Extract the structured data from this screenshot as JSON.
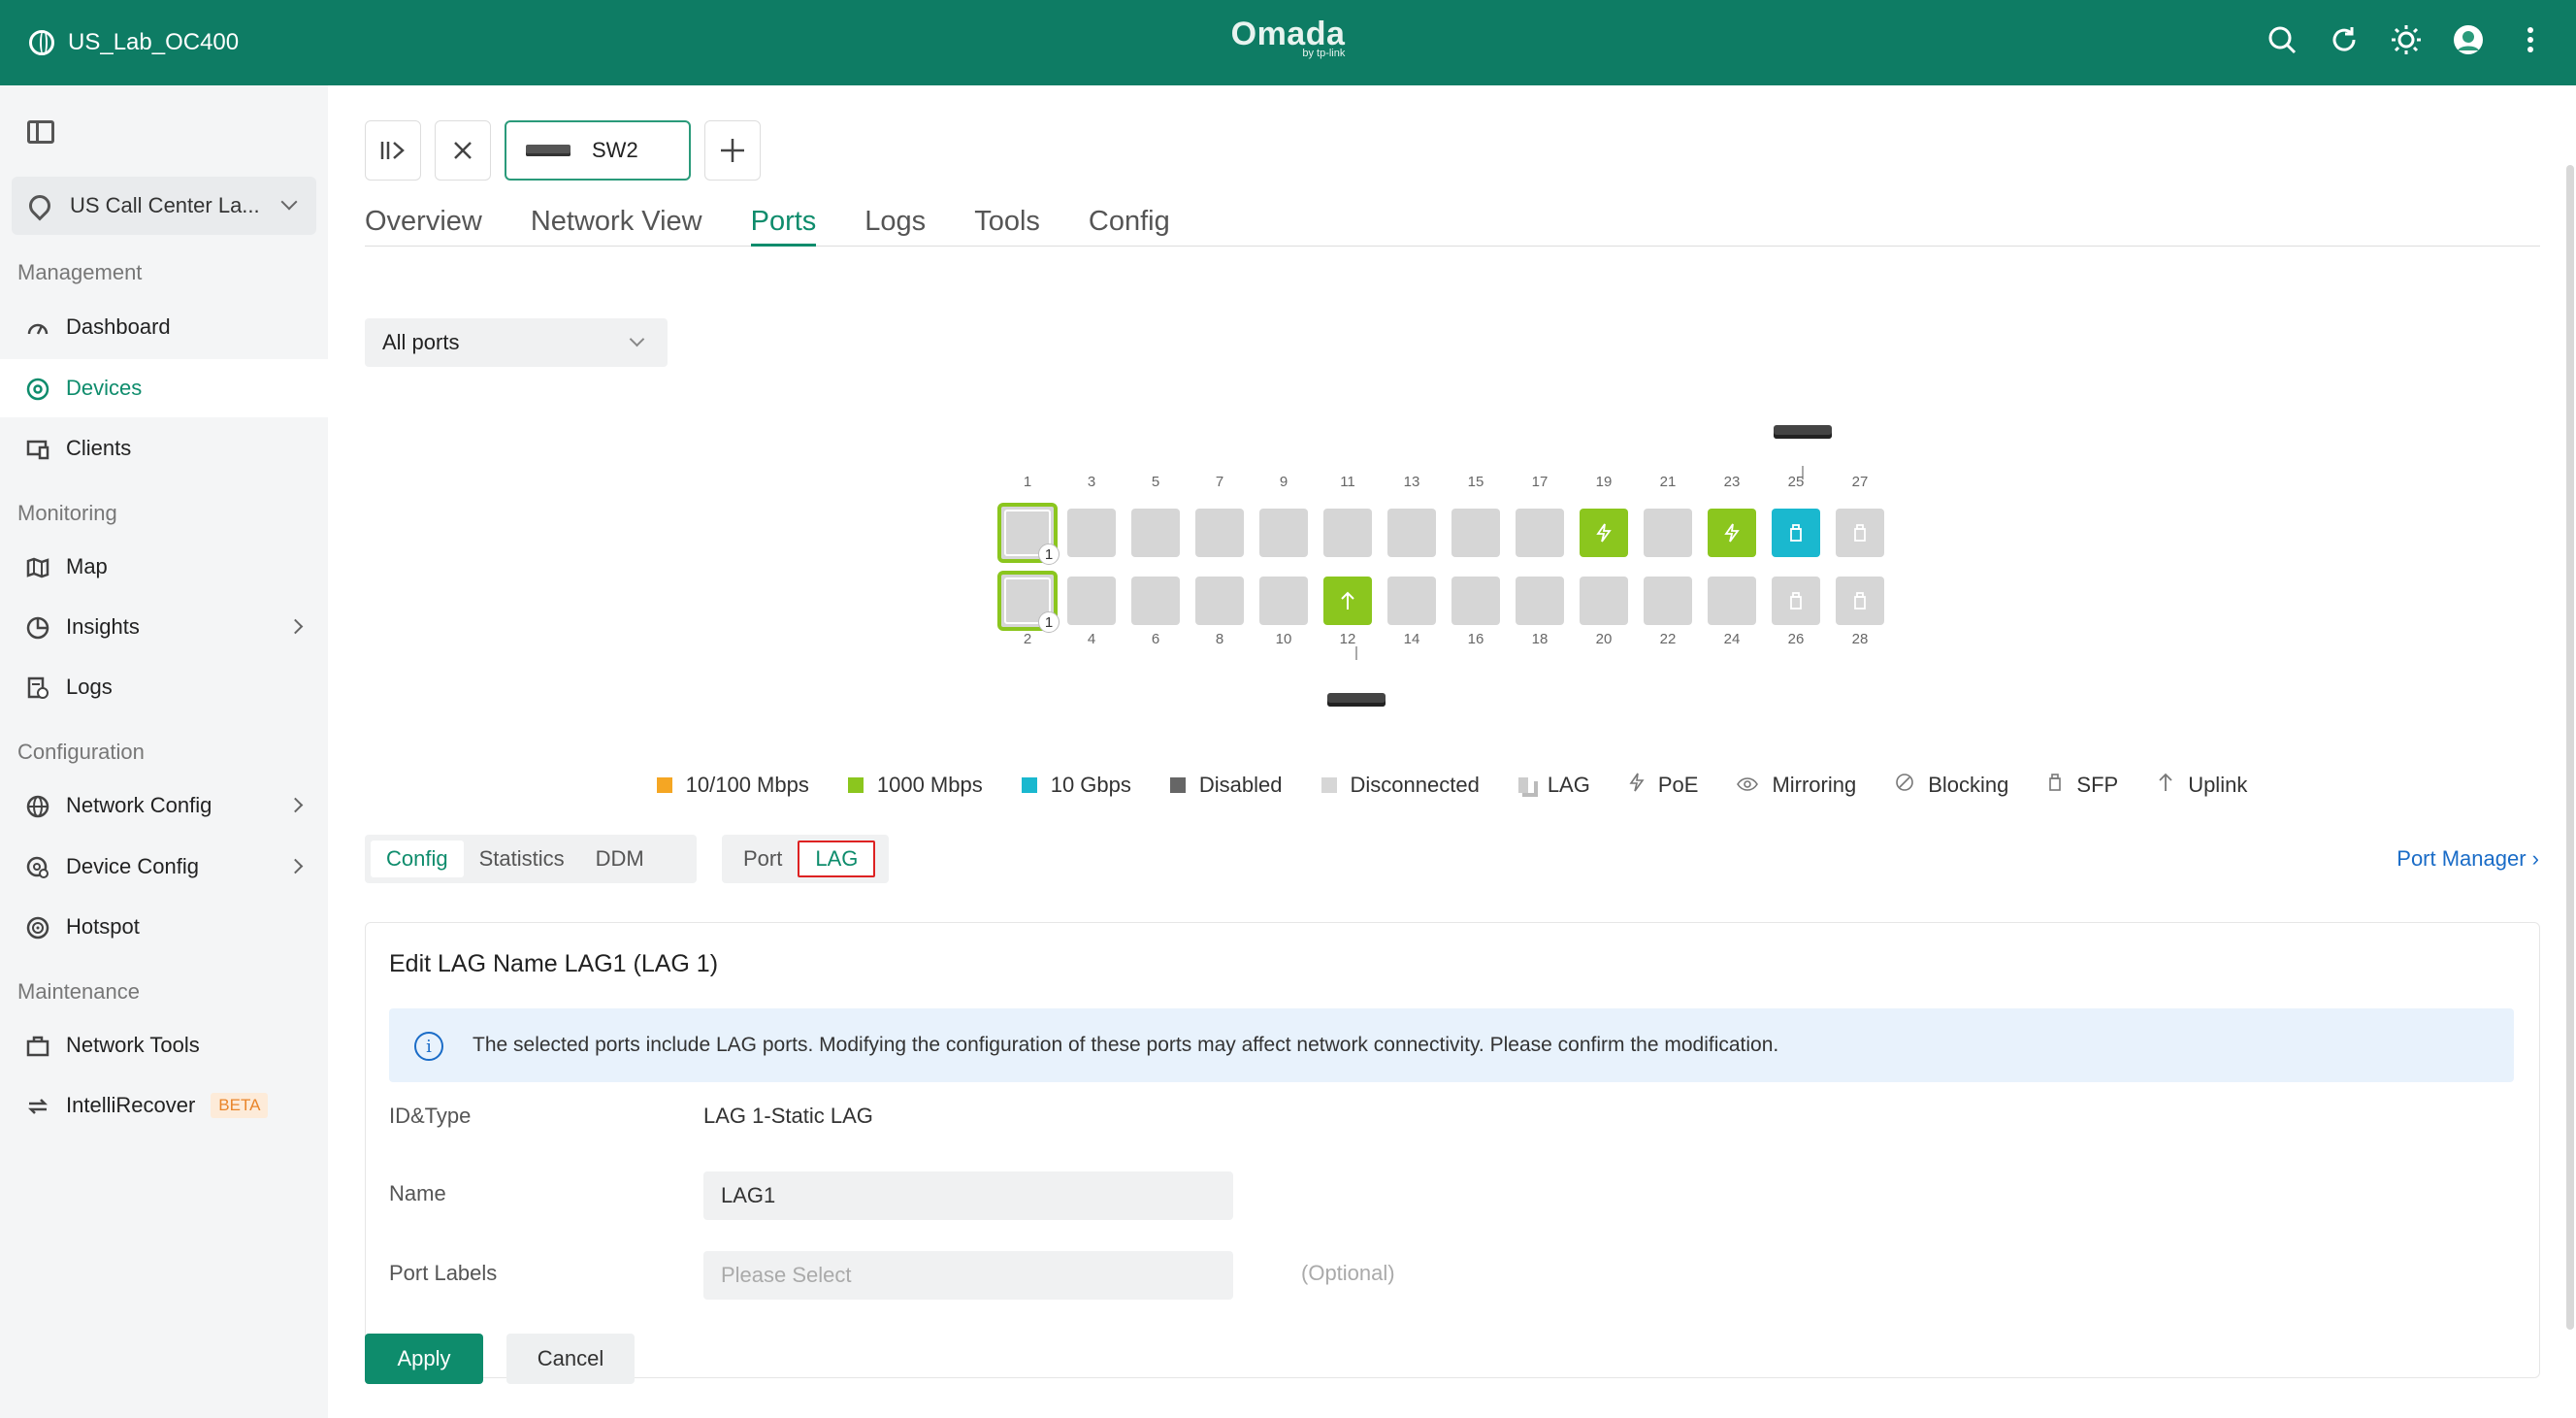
{
  "header": {
    "site_name": "US_Lab_OC400",
    "logo_main": "Omada",
    "logo_sub": "by tp-link"
  },
  "sidebar": {
    "site_select": "US Call Center La...",
    "sections": {
      "management": "Management",
      "monitoring": "Monitoring",
      "configuration": "Configuration",
      "maintenance": "Maintenance"
    },
    "items": {
      "dashboard": "Dashboard",
      "devices": "Devices",
      "clients": "Clients",
      "map": "Map",
      "insights": "Insights",
      "logs": "Logs",
      "network_config": "Network Config",
      "device_config": "Device Config",
      "hotspot": "Hotspot",
      "network_tools": "Network Tools",
      "intellirecover": "IntelliRecover",
      "beta": "BETA"
    }
  },
  "device_tab": {
    "label": "SW2"
  },
  "subnav": {
    "overview": "Overview",
    "network_view": "Network View",
    "ports": "Ports",
    "logs": "Logs",
    "tools": "Tools",
    "config": "Config"
  },
  "port_filter": {
    "value": "All ports"
  },
  "ports": {
    "top_numbers": [
      "1",
      "3",
      "5",
      "7",
      "9",
      "11",
      "13",
      "15",
      "17",
      "19",
      "21",
      "23",
      "25",
      "27"
    ],
    "bottom_numbers": [
      "2",
      "4",
      "6",
      "8",
      "10",
      "12",
      "14",
      "16",
      "18",
      "20",
      "22",
      "24",
      "26",
      "28"
    ],
    "lag_badge": "1"
  },
  "legend": {
    "speed_100": "10/100 Mbps",
    "speed_1000": "1000 Mbps",
    "speed_10g": "10 Gbps",
    "disabled": "Disabled",
    "disconnected": "Disconnected",
    "lag": "LAG",
    "poe": "PoE",
    "mirroring": "Mirroring",
    "blocking": "Blocking",
    "sfp": "SFP",
    "uplink": "Uplink"
  },
  "seg_tabs": {
    "config": "Config",
    "statistics": "Statistics",
    "ddm": "DDM",
    "port": "Port",
    "lag": "LAG"
  },
  "port_manager": "Port Manager ›",
  "form": {
    "title": "Edit LAG Name LAG1 (LAG 1)",
    "notice": "The selected ports include LAG ports. Modifying the configuration of these ports may affect network connectivity. Please confirm the modification.",
    "id_type_label": "ID&Type",
    "id_type_value": "LAG 1-Static LAG",
    "name_label": "Name",
    "name_value": "LAG1",
    "port_labels_label": "Port Labels",
    "port_labels_placeholder": "Please Select",
    "optional": "(Optional)"
  },
  "buttons": {
    "apply": "Apply",
    "cancel": "Cancel"
  },
  "colors": {
    "brand": "#0e7c64",
    "speed_100": "#f5a623",
    "speed_1000": "#8bc61e",
    "speed_10g": "#1ab8cf",
    "disabled": "#666666",
    "disconnected": "#d6d6d6"
  }
}
